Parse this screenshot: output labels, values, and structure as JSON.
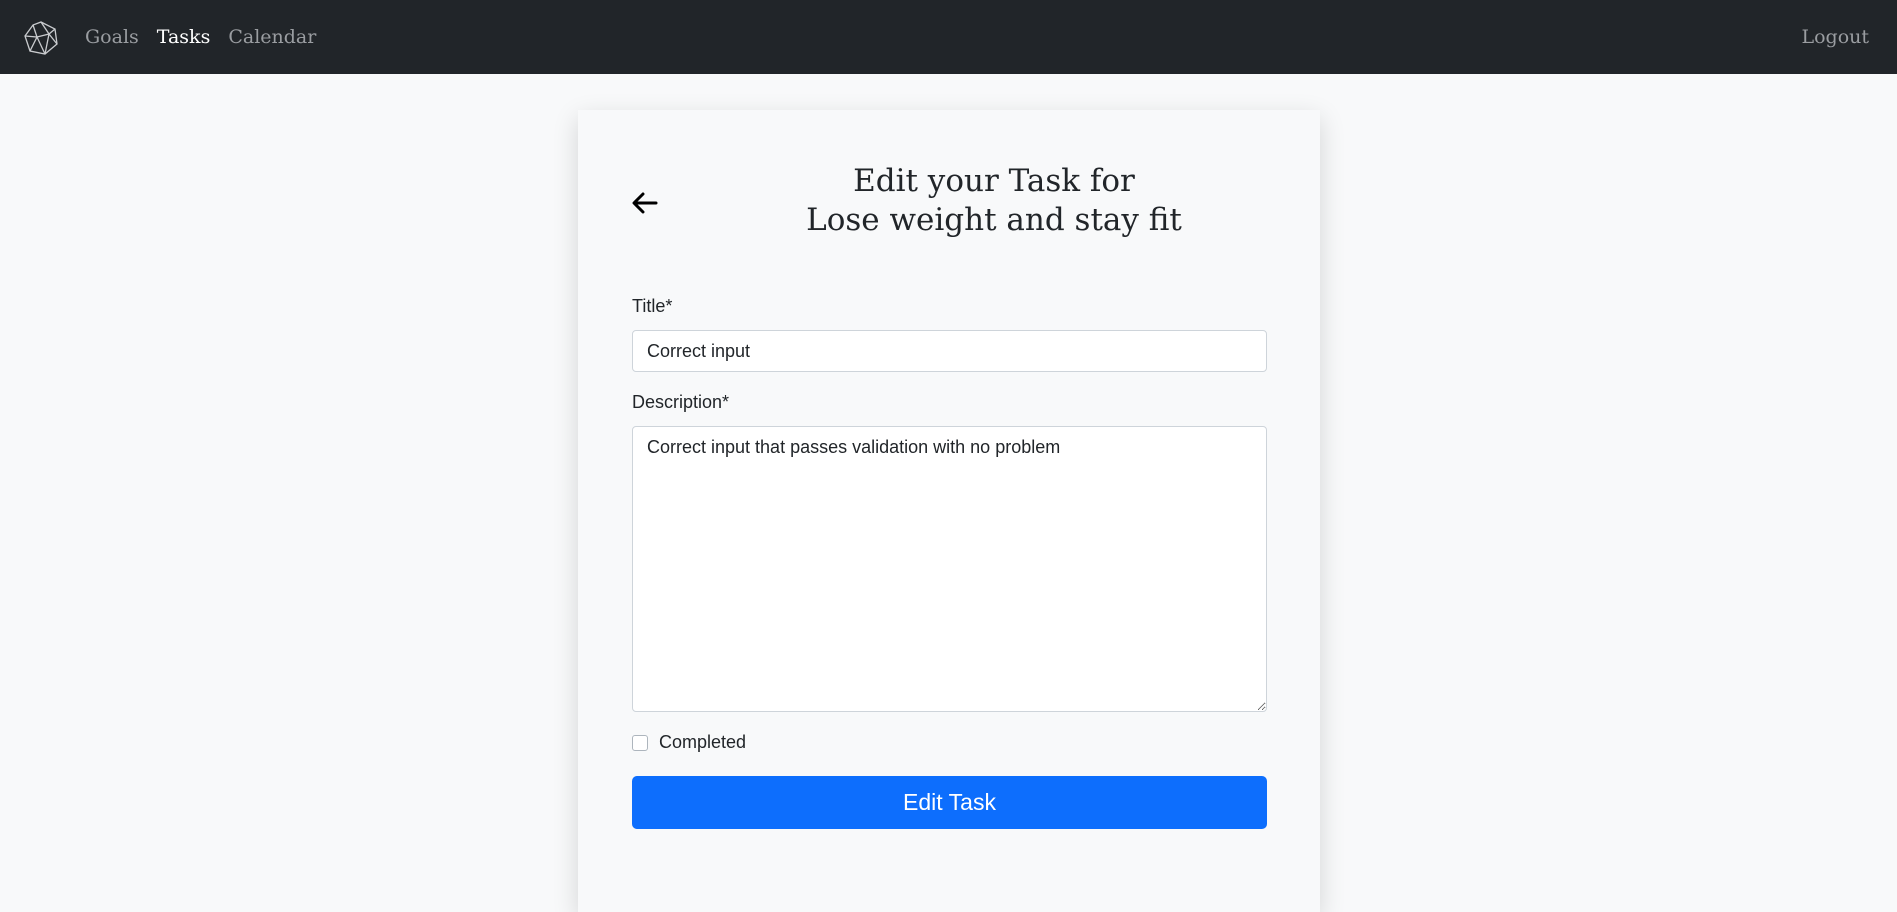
{
  "navbar": {
    "brand_icon": "geometric-polyhedron-logo",
    "links": [
      {
        "label": "Goals",
        "active": false
      },
      {
        "label": "Tasks",
        "active": true
      },
      {
        "label": "Calendar",
        "active": false
      }
    ],
    "logout_label": "Logout"
  },
  "form": {
    "back_icon": "arrow-left-icon",
    "heading_line1": "Edit your Task for",
    "heading_line2": "Lose weight and stay fit",
    "title_label": "Title*",
    "title_value": "Correct input",
    "description_label": "Description*",
    "description_value": "Correct input that passes validation with no problem",
    "completed_label": "Completed",
    "completed_checked": false,
    "submit_label": "Edit Task"
  },
  "colors": {
    "navbar_bg": "#212529",
    "page_bg": "#f8f9fa",
    "primary": "#0d6efd"
  }
}
